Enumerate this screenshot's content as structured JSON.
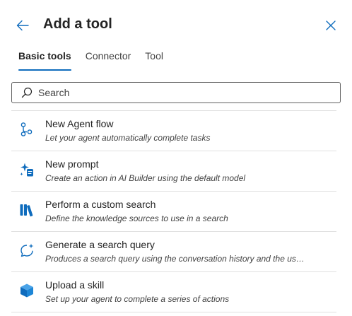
{
  "header": {
    "title": "Add a tool",
    "back_icon": "arrow-left-icon",
    "close_icon": "close-icon"
  },
  "tabs": [
    {
      "label": "Basic tools",
      "active": true
    },
    {
      "label": "Connector",
      "active": false
    },
    {
      "label": "Tool",
      "active": false
    }
  ],
  "search": {
    "placeholder": "Search",
    "value": "",
    "icon": "search-icon"
  },
  "tools": [
    {
      "title": "New Agent flow",
      "description": "Let your agent automatically complete tasks",
      "icon": "flow-icon"
    },
    {
      "title": "New prompt",
      "description": "Create an action in AI Builder using the default model",
      "icon": "prompt-icon"
    },
    {
      "title": "Perform a custom search",
      "description": "Define the knowledge sources to use in a search",
      "icon": "library-icon"
    },
    {
      "title": "Generate a search query",
      "description": "Produces a search query using the conversation history and the user i...",
      "icon": "chat-sparkle-icon"
    },
    {
      "title": "Upload a skill",
      "description": "Set up your agent to complete a series of actions",
      "icon": "cube-icon"
    }
  ],
  "colors": {
    "accent": "#0f6cbd",
    "text_primary": "#242424",
    "text_secondary": "#424242",
    "divider": "#e0e0e0"
  }
}
